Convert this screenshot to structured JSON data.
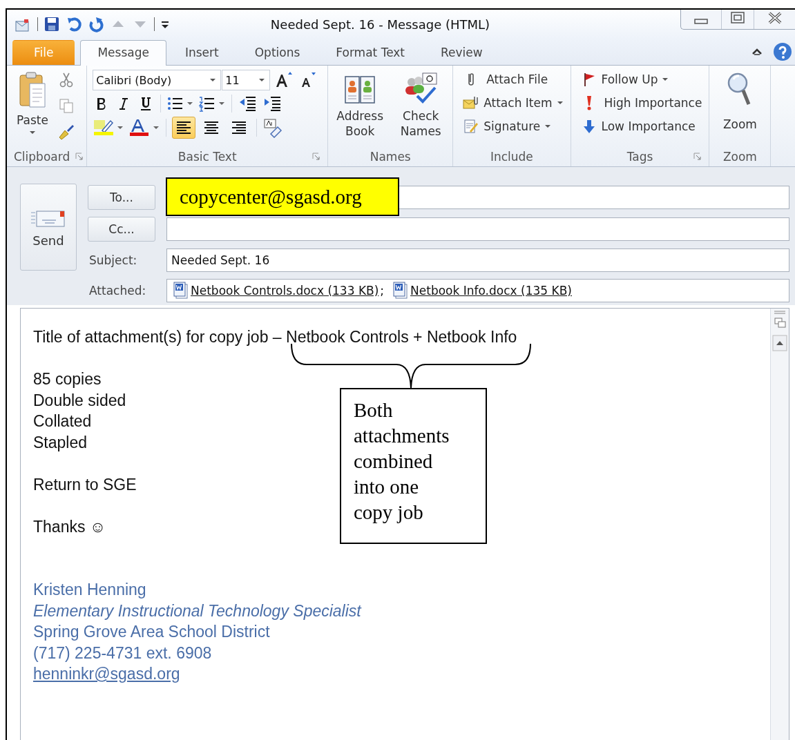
{
  "window": {
    "title": "Needed Sept. 16  -  Message (HTML)"
  },
  "tabs": [
    {
      "label": "File",
      "kind": "file",
      "selected": false
    },
    {
      "label": "Message",
      "kind": "tab",
      "selected": true
    },
    {
      "label": "Insert",
      "kind": "tab",
      "selected": false
    },
    {
      "label": "Options",
      "kind": "tab",
      "selected": false
    },
    {
      "label": "Format Text",
      "kind": "tab",
      "selected": false
    },
    {
      "label": "Review",
      "kind": "tab",
      "selected": false
    }
  ],
  "ribbon": {
    "groups": [
      {
        "label": "Clipboard",
        "kind": "clipboard",
        "launcher": true,
        "items": [
          {
            "label": "Paste",
            "dropdown": true
          }
        ]
      },
      {
        "label": "Basic Text",
        "kind": "basic_text",
        "launcher": true,
        "font": "Calibri (Body)",
        "size": "11",
        "alignment": [
          {
            "selected": true
          },
          {
            "selected": false
          },
          {
            "selected": false
          }
        ]
      },
      {
        "label": "Names",
        "kind": "large",
        "launcher": false,
        "items": [
          {
            "label": "Address Book"
          },
          {
            "label": "Check Names"
          }
        ]
      },
      {
        "label": "Include",
        "kind": "small",
        "launcher": false,
        "items": [
          {
            "label": "Attach File"
          },
          {
            "label": "Attach Item",
            "dropdown": true
          },
          {
            "label": "Signature",
            "dropdown": true
          }
        ]
      },
      {
        "label": "Tags",
        "kind": "small",
        "launcher": true,
        "items": [
          {
            "label": "Follow Up",
            "dropdown": true
          },
          {
            "label": "High Importance"
          },
          {
            "label": "Low Importance"
          }
        ]
      },
      {
        "label": "Zoom",
        "kind": "zoom",
        "launcher": false,
        "items": [
          {
            "label": "Zoom"
          }
        ]
      }
    ]
  },
  "header": {
    "send": "Send",
    "to_button": "To...",
    "cc_button": "Cc...",
    "subject_label": "Subject:",
    "subject": "Needed Sept. 16",
    "attached_label": "Attached:",
    "attachments": [
      {
        "name": "Netbook Controls.docx (133 KB)",
        "separator": ";"
      },
      {
        "name": "Netbook Info.docx (135 KB)"
      }
    ]
  },
  "body": {
    "paragraphs": [
      [
        "Title of attachment(s) for copy job – Netbook Controls + Netbook Info"
      ],
      [
        "85 copies",
        "Double sided",
        "Collated",
        "Stapled"
      ],
      [
        "Return to SGE"
      ],
      [
        "Thanks ☺"
      ]
    ],
    "signature": [
      {
        "text": "Kristen Henning",
        "kind": "name"
      },
      {
        "text": "Elementary Instructional Technology Specialist",
        "kind": "title"
      },
      {
        "text": "Spring Grove Area School District",
        "kind": "org"
      },
      {
        "text": "(717) 225-4731 ext. 6908",
        "kind": "phone"
      },
      {
        "text": "henninkr@sgasd.org",
        "kind": "email"
      }
    ]
  },
  "annotations": {
    "recipient_callout": "copycenter@sgasd.org",
    "note": [
      "Both",
      "attachments",
      "combined",
      "into one",
      "copy job"
    ]
  }
}
